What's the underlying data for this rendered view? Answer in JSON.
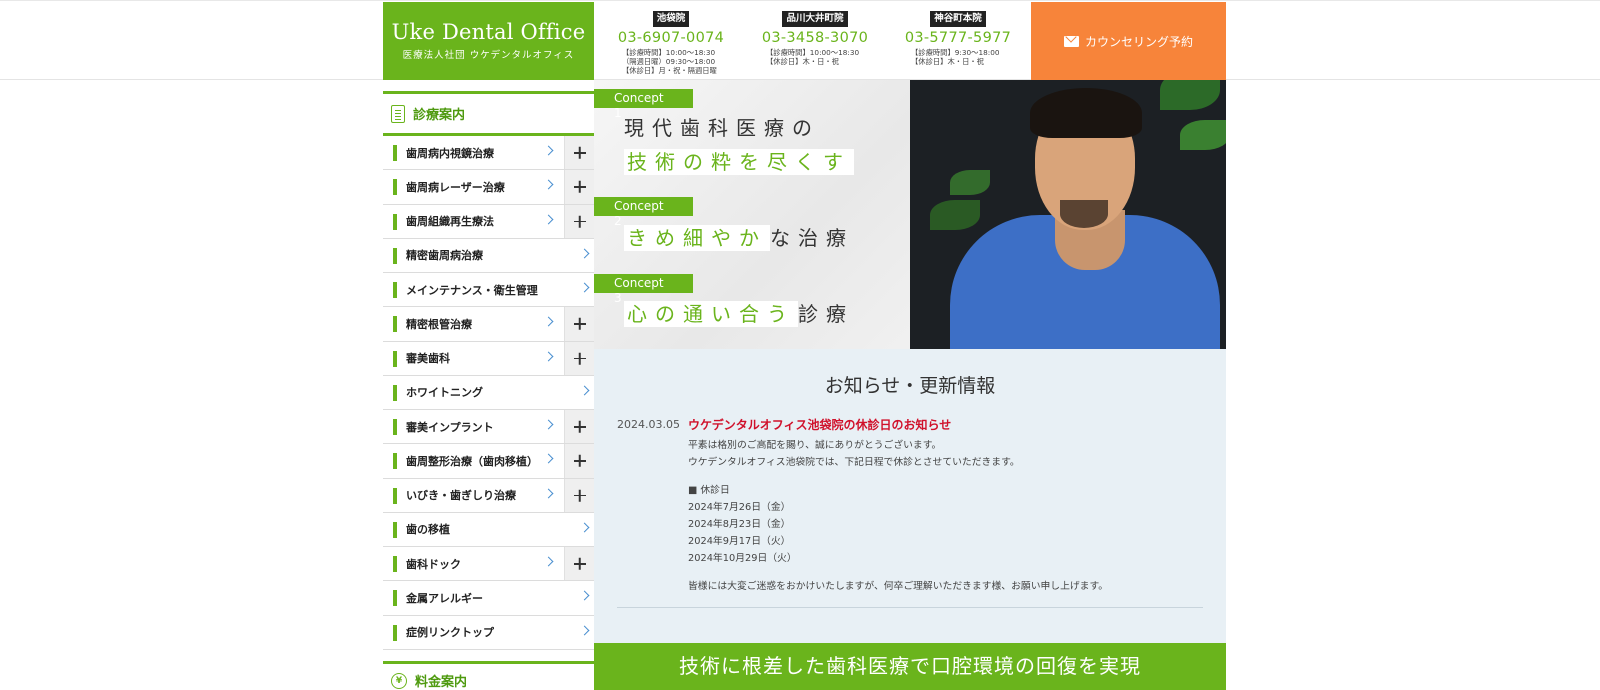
{
  "header": {
    "logo_main": "Uke Dental Office",
    "logo_sub": "医療法人社団 ウケデンタルオフィス",
    "clinics": [
      {
        "name": "池袋院",
        "phone": "03-6907-0074",
        "hours": [
          "【診療時間】10:00〜18:30",
          "（隔週日曜）09:30〜18:00",
          "【休診日】月・祝・隔週日曜"
        ]
      },
      {
        "name": "品川大井町院",
        "phone": "03-3458-3070",
        "hours": [
          "【診療時間】10:00〜18:30",
          "【休診日】木・日・祝"
        ]
      },
      {
        "name": "神谷町本院",
        "phone": "03-5777-5977",
        "hours": [
          "【診療時間】9:30〜18:00",
          "【休診日】木・日・祝"
        ]
      }
    ],
    "reserve_label": "カウンセリング予約"
  },
  "sidebar": {
    "section_title": "診療案内",
    "items": [
      {
        "label": "歯周病内視鏡治療"
      },
      {
        "label": "歯周病レーザー治療"
      },
      {
        "label": "歯周組織再生療法"
      },
      {
        "label": "精密歯周病治療"
      },
      {
        "label": "メインテナンス・衛生管理"
      },
      {
        "label": "精密根管治療"
      },
      {
        "label": "審美歯科"
      },
      {
        "label": "ホワイトニング"
      },
      {
        "label": "審美インプラント"
      },
      {
        "label": "歯周整形治療（歯肉移植）"
      },
      {
        "label": "いびき・歯ぎしり治療"
      },
      {
        "label": "歯の移植"
      },
      {
        "label": "歯科ドック"
      },
      {
        "label": "金属アレルギー"
      },
      {
        "label": "症例リンクトップ"
      }
    ],
    "section2_title": "料金案内"
  },
  "hero": {
    "concepts": [
      {
        "tag": "Concept 1",
        "line1": "現代歯科医療の",
        "line2_hl": "技術の粋を尽くす"
      },
      {
        "tag": "Concept 2",
        "hl": "きめ細やか",
        "rest": "な治療"
      },
      {
        "tag": "Concept 3",
        "hl": "心の通い合う",
        "rest": "診療"
      }
    ]
  },
  "news": {
    "title": "お知らせ・更新情報",
    "date": "2024.03.05",
    "heading": "ウケデンタルオフィス池袋院の休診日のお知らせ",
    "intro": [
      "平素は格別のご高配を賜り、誠にありがとうございます。",
      "ウケデンタルオフィス池袋院では、下記日程で休診とさせていただきます。"
    ],
    "closed_label": "■ 休診日",
    "closed_dates": [
      "2024年7月26日（金）",
      "2024年8月23日（金）",
      "2024年9月17日（火）",
      "2024年10月29日（火）"
    ],
    "outro": "皆様には大変ご迷惑をおかけいたしますが、何卒ご理解いただきます様、お願い申し上げます。"
  },
  "banner": {
    "text": "技術に根差した歯科医療で口腔環境の回復を実現"
  },
  "colors": {
    "brand_green": "#6ab41c",
    "accent_orange": "#f7843a",
    "news_red": "#d0112b"
  }
}
